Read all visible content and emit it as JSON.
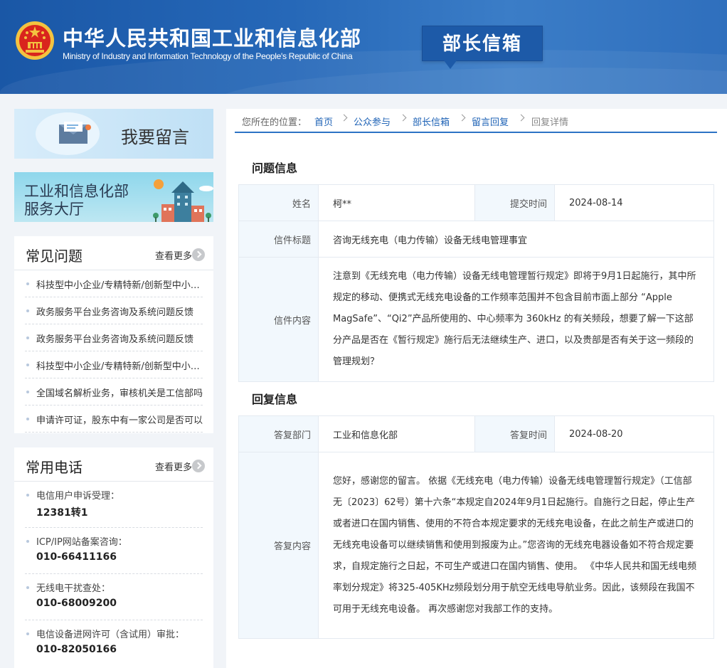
{
  "header": {
    "site_title_cn": "中华人民共和国工业和信息化部",
    "site_title_en": "Ministry of Industry and Information Technology of the People's Republic of China",
    "section_tag": "部长信箱"
  },
  "sidebar": {
    "banner_message": "我要留言",
    "banner_service_line1": "工业和信息化部",
    "banner_service_line2": "服务大厅",
    "faq": {
      "title": "常见问题",
      "more": "查看更多",
      "items": [
        "科技型中小企业/专精特新/创新型中小企业",
        "政务服务平台业务咨询及系统问题反馈",
        "政务服务平台业务咨询及系统问题反馈",
        "科技型中小企业/专精特新/创新型中小企业",
        "全国域名解析业务，审核机关是工信部吗",
        "申请许可证，股东中有一家公司是否可以"
      ]
    },
    "phones": {
      "title": "常用电话",
      "more": "查看更多",
      "items": [
        {
          "label": "电信用户申诉受理：",
          "number": "12381转1"
        },
        {
          "label": "ICP/IP网站备案咨询：",
          "number": "010-66411166"
        },
        {
          "label": "无线电干扰查处：",
          "number": "010-68009200"
        },
        {
          "label": "电信设备进网许可（含试用）审批：",
          "number": "010-82050166"
        }
      ]
    }
  },
  "breadcrumb": {
    "prefix": "您所在的位置：",
    "items": [
      "首页",
      "公众参与",
      "部长信箱",
      "留言回复",
      "回复详情"
    ]
  },
  "question": {
    "section_title": "问题信息",
    "name_label": "姓名",
    "name": "柯**",
    "time_label": "提交时间",
    "time": "2024-08-14",
    "subject_label": "信件标题",
    "subject": "咨询无线充电（电力传输）设备无线电管理事宜",
    "content_label": "信件内容",
    "content": "注意到《无线充电（电力传输）设备无线电管理暂行规定》即将于9月1日起施行，其中所规定的移动、便携式无线充电设备的工作频率范围并不包含目前市面上部分 “Apple MagSafe”、“Qi2”产品所使用的、中心频率为 360kHz 的有关频段，想要了解一下这部分产品是否在《暂行规定》施行后无法继续生产、进口，以及贵部是否有关于这一频段的管理规划？"
  },
  "reply": {
    "section_title": "回复信息",
    "dept_label": "答复部门",
    "dept": "工业和信息化部",
    "time_label": "答复时间",
    "time": "2024-08-20",
    "content_label": "答复内容",
    "content": "您好，感谢您的留言。 依据《无线充电（电力传输）设备无线电管理暂行规定》（工信部无〔2023〕62号）第十六条“本规定自2024年9月1日起施行。自施行之日起，停止生产或者进口在国内销售、使用的不符合本规定要求的无线充电设备，在此之前生产或进口的无线充电设备可以继续销售和使用到报废为止。”您咨询的无线充电器设备如不符合规定要求，自规定施行之日起，不可生产或进口在国内销售、使用。 《中华人民共和国无线电频率划分规定》将325-405KHz频段划分用于航空无线电导航业务。因此，该频段在我国不可用于无线充电设备。 再次感谢您对我部工作的支持。"
  },
  "colors": {
    "header_blue": "#2668b8",
    "link_blue": "#1f63b6",
    "accent_line": "#2d73c5",
    "label_bg": "#f2f8fd"
  }
}
